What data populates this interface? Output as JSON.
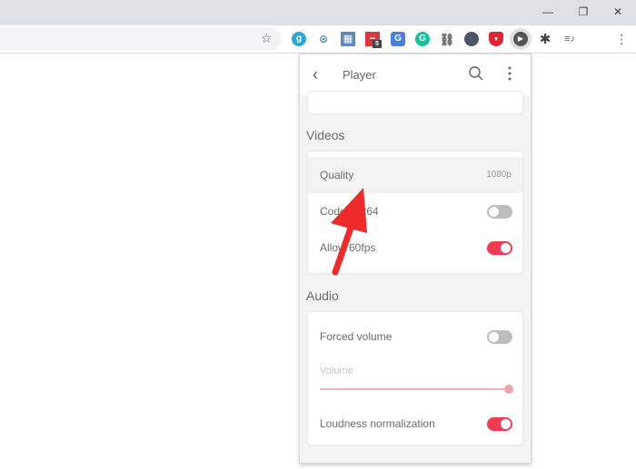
{
  "browser": {
    "window_controls": {
      "minimize": "—",
      "restore": "❐",
      "close": "✕"
    },
    "bookmark_icon": "star-icon",
    "extensions": [
      {
        "name": "extension-g",
        "glyph": "g",
        "color": "#29a8d6",
        "shape": "circle"
      },
      {
        "name": "extension-user-card",
        "glyph": "⊙",
        "color": "#3f7fbf",
        "shape": "square"
      },
      {
        "name": "extension-screenshot",
        "glyph": "▦",
        "color": "#5f89b8",
        "shape": "square"
      },
      {
        "name": "extension-red-dots",
        "glyph": "•••",
        "color": "#d9363e",
        "shape": "square",
        "badge": "5"
      },
      {
        "name": "extension-translate",
        "glyph": "G",
        "color": "#4a7fe0",
        "shape": "square"
      },
      {
        "name": "extension-grammarly",
        "glyph": "G",
        "color": "#15c39a",
        "shape": "circle"
      },
      {
        "name": "extension-link",
        "glyph": "🔗",
        "color": "#ffffff",
        "shape": "none"
      },
      {
        "name": "extension-dark-circle",
        "glyph": "◖",
        "color": "#4a5568",
        "shape": "circle"
      },
      {
        "name": "extension-shield",
        "glyph": "▼",
        "color": "#e0242f",
        "shape": "square"
      },
      {
        "name": "extension-player",
        "glyph": "▶",
        "color": "#555555",
        "shape": "circle"
      },
      {
        "name": "extension-puzzle",
        "glyph": "✱",
        "color": "#ffffff",
        "shape": "none"
      },
      {
        "name": "extension-queue-music",
        "glyph": "≡♪",
        "color": "#ffffff",
        "shape": "none"
      }
    ],
    "menu_icon": "⋮"
  },
  "popup": {
    "title": "Player",
    "back_icon": "‹",
    "more_icon": "⋮",
    "sections": {
      "videos": {
        "title": "Videos",
        "quality": {
          "label": "Quality",
          "value": "1080p"
        },
        "codec": {
          "label": "Codec h264",
          "enabled": false
        },
        "fps": {
          "label": "Allow 60fps",
          "enabled": true
        }
      },
      "audio": {
        "title": "Audio",
        "forced_volume": {
          "label": "Forced volume",
          "enabled": false
        },
        "volume": {
          "label": "Volume",
          "value_percent": 100
        },
        "loudness": {
          "label": "Loudness normalization",
          "enabled": true
        }
      }
    }
  },
  "annotation": {
    "arrow_color": "#ee2a2a"
  }
}
